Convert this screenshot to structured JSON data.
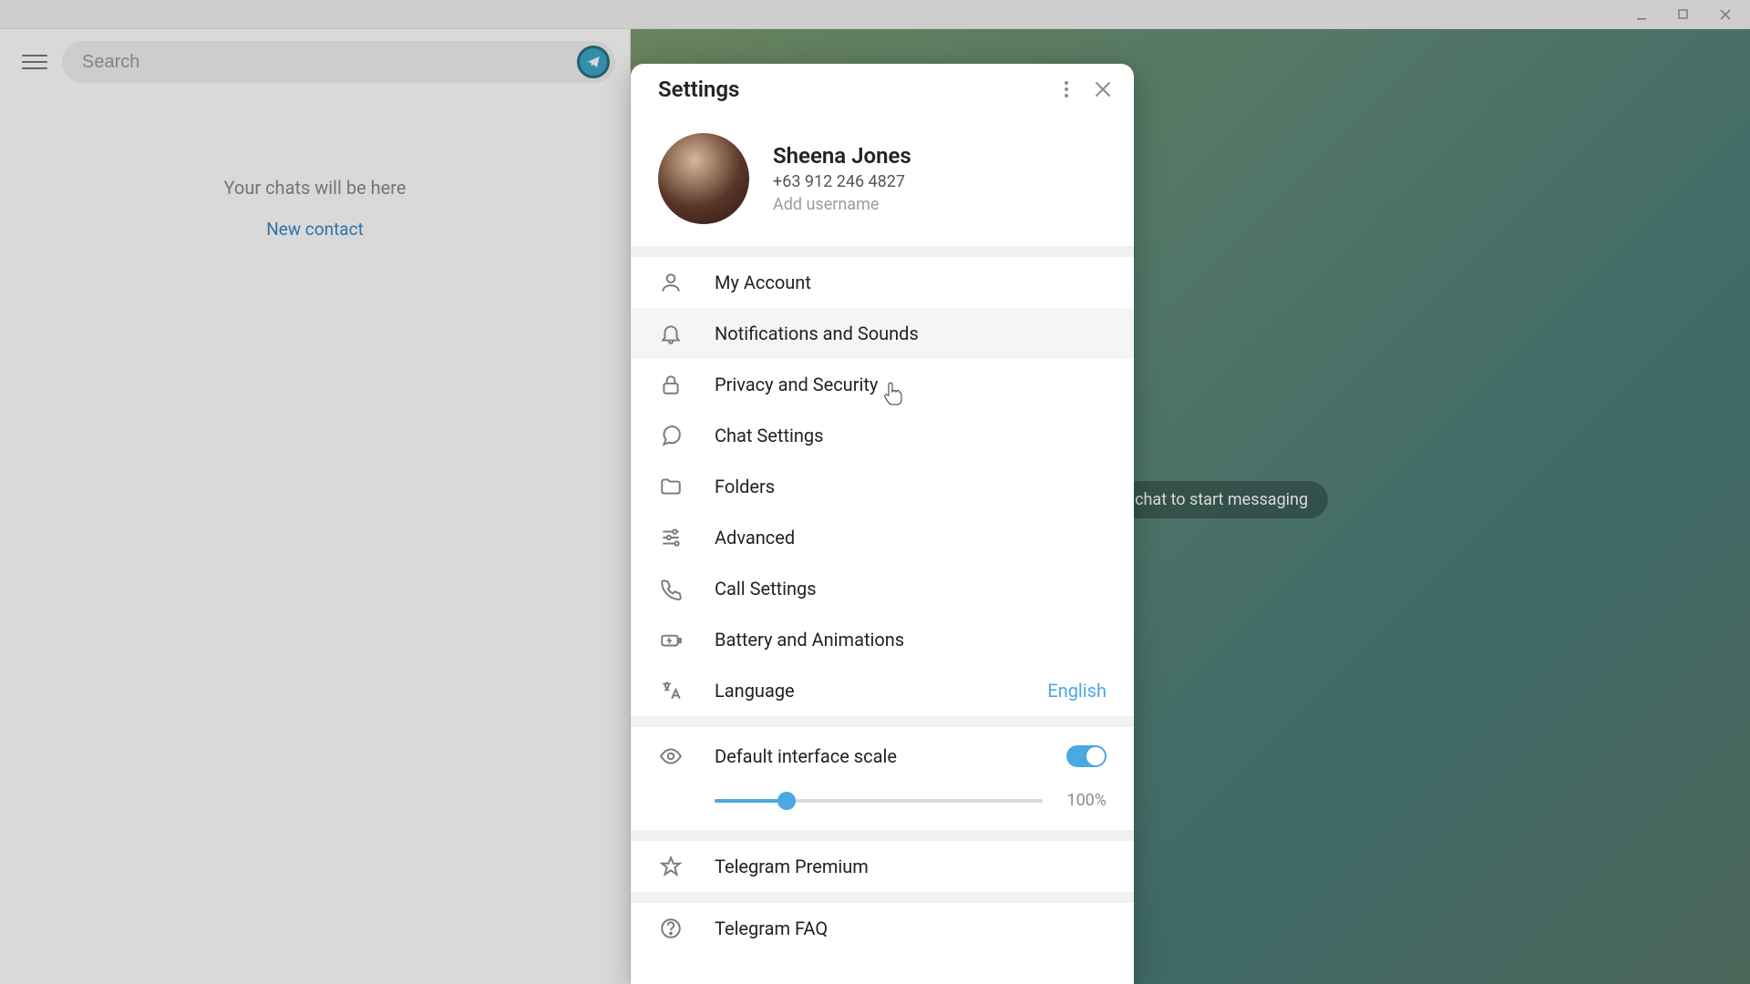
{
  "titlebar": {},
  "sidebar": {
    "search_placeholder": "Search",
    "empty_hint": "Your chats will be here",
    "new_contact": "New contact"
  },
  "chat": {
    "hint": "Select a chat to start messaging"
  },
  "settings": {
    "title": "Settings",
    "profile": {
      "name": "Sheena Jones",
      "phone": "+63 912 246 4827",
      "add_username": "Add username"
    },
    "items": {
      "my_account": "My Account",
      "notifications": "Notifications and Sounds",
      "privacy": "Privacy and Security",
      "chat": "Chat Settings",
      "folders": "Folders",
      "advanced": "Advanced",
      "calls": "Call Settings",
      "battery": "Battery and Animations",
      "language": "Language",
      "language_value": "English",
      "scale": "Default interface scale",
      "scale_value": "100%",
      "premium": "Telegram Premium",
      "faq": "Telegram FAQ"
    }
  }
}
